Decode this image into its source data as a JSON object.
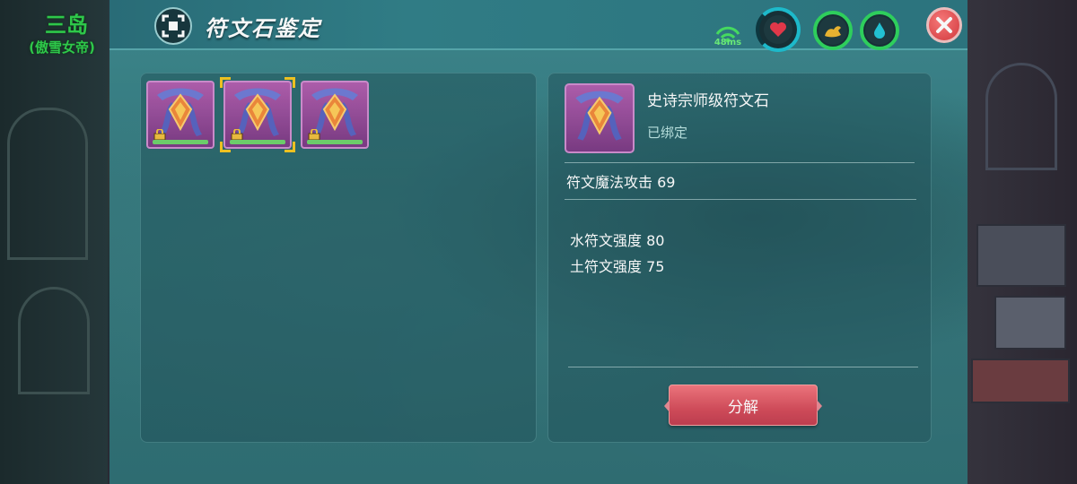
{
  "hud": {
    "region_name": "三岛",
    "region_sub": "(傲雪女帝)",
    "ping": "48ms"
  },
  "window": {
    "title": "符文石鉴定",
    "title_icon": "identify-icon",
    "close_icon": "close-icon"
  },
  "status_gauges": [
    {
      "icon": "heart-icon",
      "color": "#e8394a"
    },
    {
      "icon": "strength-arm-icon",
      "color": "#f0b830"
    },
    {
      "icon": "water-drop-icon",
      "color": "#23c7d8"
    }
  ],
  "inventory": {
    "slots": [
      {
        "item": "rune-stone",
        "locked": true,
        "selected": false
      },
      {
        "item": "rune-stone",
        "locked": true,
        "selected": true
      },
      {
        "item": "rune-stone",
        "locked": true,
        "selected": false
      }
    ]
  },
  "detail": {
    "item_name": "史诗宗师级符文石",
    "bind_status": "已绑定",
    "main_stat": "符文魔法攻击 69",
    "sub_stats": [
      "水符文强度 80",
      "土符文强度 75"
    ],
    "action_label": "分解"
  },
  "colors": {
    "window_bg": "#35787d",
    "accent_green": "#2ec84a",
    "action_red": "#d44c5a",
    "select_gold": "#f6c620",
    "item_purple": "#9b4da0"
  }
}
